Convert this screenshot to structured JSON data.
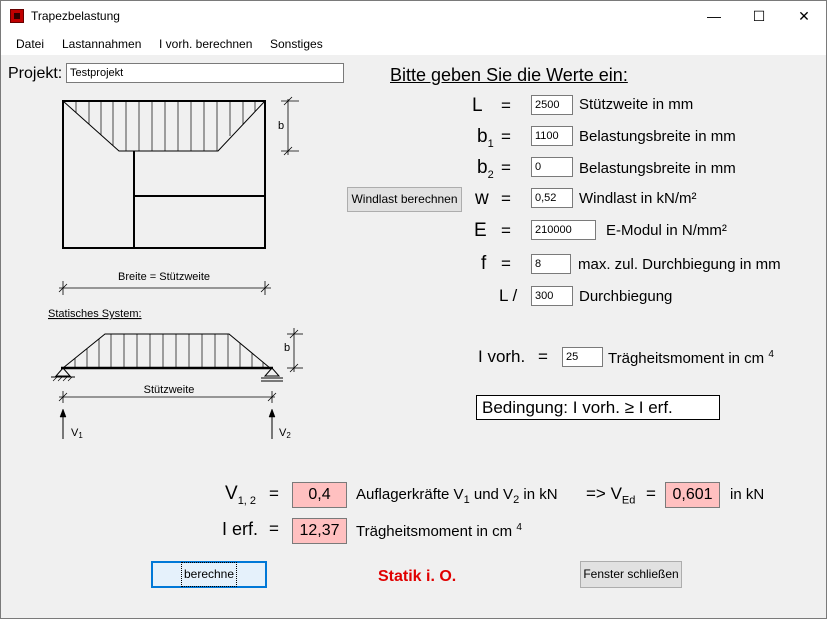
{
  "window": {
    "title": "Trapezbelastung",
    "minimize": "—",
    "maximize": "☐",
    "close": "✕"
  },
  "menu": [
    "Datei",
    "Lastannahmen",
    "I vorh. berechnen",
    "Sonstiges"
  ],
  "project": {
    "label": "Projekt:",
    "value": "Testprojekt"
  },
  "heading": "Bitte geben Sie die Werte ein:",
  "inputs": {
    "L": {
      "symbol": "L",
      "eq": "=",
      "value": "2500",
      "desc": "Stützweite in mm"
    },
    "b1": {
      "symbol": "b",
      "sub": "1",
      "eq": "=",
      "value": "1100",
      "desc": "Belastungsbreite in mm"
    },
    "b2": {
      "symbol": "b",
      "sub": "2",
      "eq": "=",
      "value": "0",
      "desc": "Belastungsbreite in mm"
    },
    "w": {
      "symbol": "w",
      "eq": "=",
      "value": "0,52",
      "desc": "Windlast in kN/m²"
    },
    "E": {
      "symbol": "E",
      "eq": "=",
      "value": "210000",
      "desc": "E-Modul in N/mm²"
    },
    "f": {
      "symbol": "f",
      "eq": "=",
      "value": "8",
      "desc": "max. zul. Durchbiegung in mm"
    },
    "Lratio": {
      "symbol": "L /",
      "value": "300",
      "desc": "Durchbiegung"
    }
  },
  "windlast_button": "Windlast berechnen",
  "ivorh": {
    "label": "I vorh.",
    "eq": "=",
    "value": "25",
    "desc": "Trägheitsmoment in cm",
    "exp": "4"
  },
  "condition": "Bedingung:   I vorh.  ≥  I erf.",
  "results": {
    "v12": {
      "label": "V",
      "sub": "1, 2",
      "eq": "=",
      "value": "0,4",
      "desc_a": "Auflagerkräfte V",
      "sub1": "1",
      "desc_b": " und V",
      "sub2": "2",
      "desc_c": " in kN"
    },
    "ved": {
      "arrow": "=> V",
      "sub": "Ed",
      "eq": "=",
      "value": "0,601",
      "unit": "in kN"
    },
    "ierf": {
      "label": "I erf.",
      "eq": "=",
      "value": "12,37",
      "desc": "Trägheitsmoment in cm",
      "exp": "4"
    }
  },
  "buttons": {
    "calc": "berechne",
    "close": "Fenster schließen"
  },
  "status": {
    "text": "Statik i. O.",
    "color": "#e00000"
  },
  "diagram": {
    "b_label": "b",
    "breite_label": "Breite = Stützweite",
    "statisches_label": "Statisches System:",
    "b2_label": "b",
    "stuetzweite_label": "Stützweite",
    "v1": "V",
    "v1_sub": "1",
    "v2": "V",
    "v2_sub": "2"
  },
  "colors": {
    "result_bg": "#ffc0c0",
    "accent": "#0078d7"
  }
}
